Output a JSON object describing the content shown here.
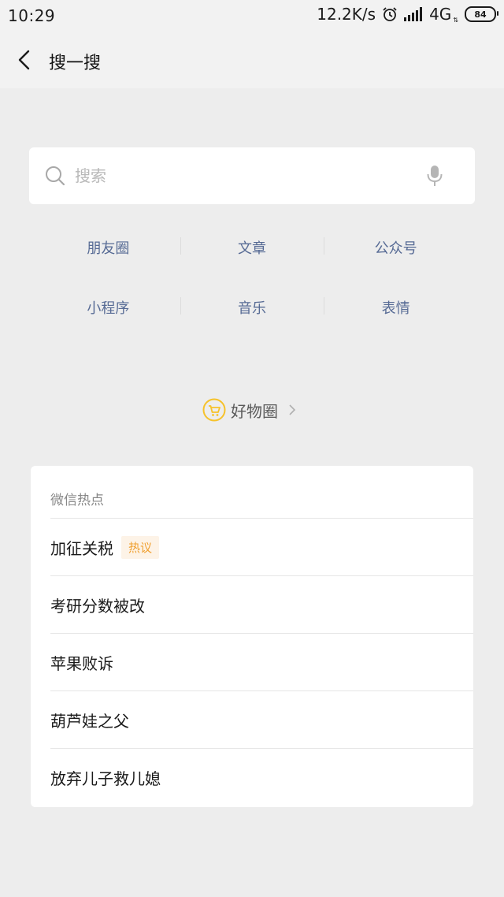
{
  "status_bar": {
    "time": "10:29",
    "net_speed": "12.2K/s",
    "network": "4G",
    "battery": "84"
  },
  "nav": {
    "title": "搜一搜"
  },
  "search": {
    "placeholder": "搜索"
  },
  "categories": [
    [
      "朋友圈",
      "文章",
      "公众号"
    ],
    [
      "小程序",
      "音乐",
      "表情"
    ]
  ],
  "goods_circle": {
    "label": "好物圈"
  },
  "hot_section": {
    "title": "微信热点",
    "items": [
      {
        "text": "加征关税",
        "tag": "热议"
      },
      {
        "text": "考研分数被改",
        "tag": ""
      },
      {
        "text": "苹果败诉",
        "tag": ""
      },
      {
        "text": "葫芦娃之父",
        "tag": ""
      },
      {
        "text": "放弃儿子救儿媳",
        "tag": ""
      }
    ]
  },
  "colors": {
    "background": "#ededed",
    "link": "#576b95",
    "tag_text": "#f0a030",
    "tag_bg": "#fdf3e7",
    "goods_icon": "#f6c22a"
  }
}
